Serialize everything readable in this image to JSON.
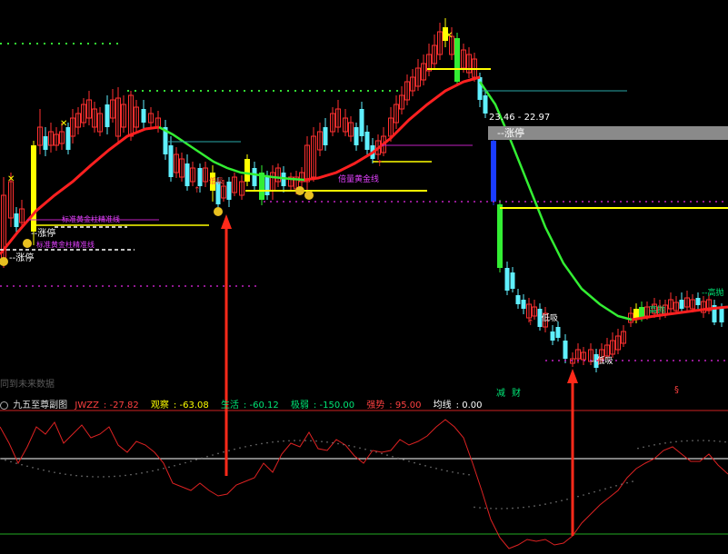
{
  "chart_data": [
    {
      "type": "candlestick",
      "description_labels": {
        "tooltip": "--涨停",
        "price_readout": "23.46 - 22.97",
        "annotations": [
          {
            "text": "标准黄金柱精准线",
            "color": "#e040fb"
          },
          {
            "text": "标准黄金柱精准线",
            "color": "#e040fb"
          },
          {
            "text": "--涨停",
            "color": "#ffffff"
          },
          {
            "text": "--涨停",
            "color": "#ffffff"
          },
          {
            "text": "倍量黄金线",
            "color": "#e040fb"
          },
          {
            "text": "低吸",
            "color": "#ffffff"
          },
          {
            "text": "--低吸",
            "color": "#ffffff"
          },
          {
            "text": "高抛",
            "color": "#00e676"
          },
          {
            "text": "--高抛",
            "color": "#00e676"
          },
          {
            "text": "低吸",
            "color": "#ff4040"
          }
        ]
      },
      "future_note": "同到未来数据"
    },
    {
      "type": "line",
      "title": "九五至尊副图",
      "indicators": [
        {
          "name": "JWZZ",
          "value": "-27.82",
          "color": "#ff4040"
        },
        {
          "name": "观察",
          "value": "-63.08",
          "color": "#ffff00"
        },
        {
          "name": "生活",
          "value": "-60.12",
          "color": "#00e676"
        },
        {
          "name": "极弱",
          "value": "-150.00",
          "color": "#00e676"
        },
        {
          "name": "强势",
          "value": "95.00",
          "color": "#ff4040"
        },
        {
          "name": "均线",
          "value": "0.00",
          "color": "#ffffff"
        }
      ],
      "markers": [
        {
          "text": "减",
          "color": "#00e676"
        },
        {
          "text": "财",
          "color": "#00e676"
        },
        {
          "text": "§",
          "color": "#ff4040"
        }
      ]
    }
  ],
  "colors": {
    "up": "#ff3030",
    "down": "#5ff0ff",
    "ma_red": "#ff2020",
    "ma_green": "#33ee33",
    "yellow": "#ffff00",
    "magenta": "#e040fb",
    "arrow": "#ff2a1a"
  },
  "sub_header_icon": "circle-icon"
}
